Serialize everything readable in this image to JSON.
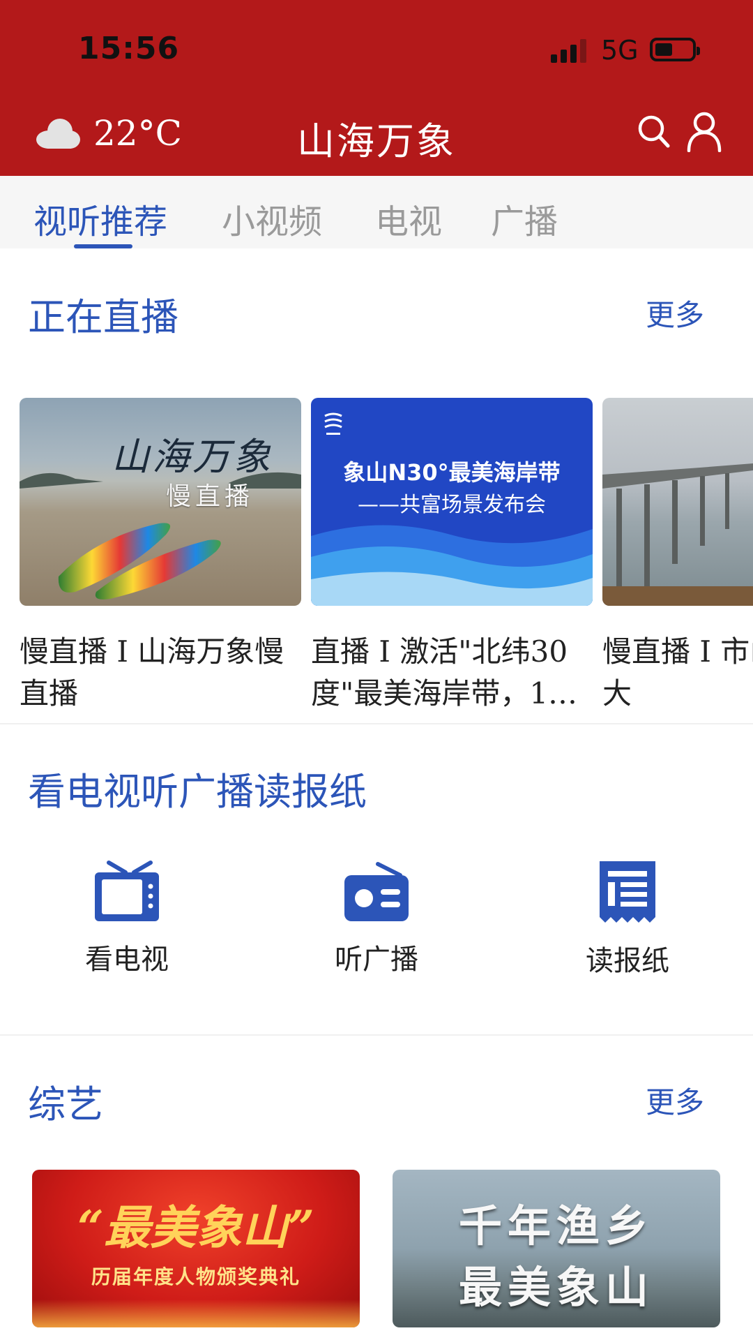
{
  "status_bar": {
    "time": "15:56",
    "network": "5G"
  },
  "header": {
    "weather_icon": "cloud-icon",
    "temperature": "22°C",
    "title": "山海万象"
  },
  "tabs": [
    {
      "label": "视听推荐",
      "active": true
    },
    {
      "label": "小视频",
      "active": false
    },
    {
      "label": "电视",
      "active": false
    },
    {
      "label": "广播",
      "active": false
    }
  ],
  "live": {
    "title": "正在直播",
    "more": "更多",
    "cards": [
      {
        "title": "慢直播 I 山海万象慢直播",
        "thumb_title": "山海万象",
        "thumb_subtitle": "慢直播"
      },
      {
        "title": "直播 I 激活\"北纬30度\"最美海岸带，1…",
        "thumb_line1": "象山N30°最美海岸带",
        "thumb_line2": "——共富场景发布会"
      },
      {
        "title": "慢直播 I 市山港跨海大"
      }
    ]
  },
  "media": {
    "title": "看电视听广播读报纸",
    "entries": [
      {
        "label": "看电视",
        "icon": "tv-icon"
      },
      {
        "label": "听广播",
        "icon": "radio-icon"
      },
      {
        "label": "读报纸",
        "icon": "newspaper-icon"
      }
    ]
  },
  "variety": {
    "title": "综艺",
    "more": "更多",
    "cards": [
      {
        "line1": "“最美象山”",
        "line2": "历届年度人物颁奖典礼"
      },
      {
        "line1": "千年渔乡",
        "line2": "最美象山"
      }
    ]
  },
  "colors": {
    "brand_red": "#b3191a",
    "accent_blue": "#2c55b8"
  }
}
